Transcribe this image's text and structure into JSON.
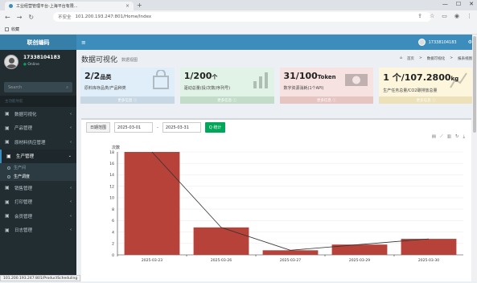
{
  "browser": {
    "tab_title": "工业经营管理平台-上海平台有限...",
    "security": "不安全",
    "url": "101.200.193.247:801/Home/Index",
    "bookmarks_label": "收藏"
  },
  "sidebar": {
    "logo": "联创编码",
    "user_name": "17338104183",
    "user_status": "Online",
    "search_placeholder": "Search",
    "section_header": "主功能导航",
    "items": [
      {
        "label": "数据可视化",
        "icon": "dashboard-icon"
      },
      {
        "label": "产品管理",
        "icon": "product-icon"
      },
      {
        "label": "原材料供应管理",
        "icon": "supply-icon"
      },
      {
        "label": "生产管理",
        "icon": "production-icon",
        "expanded": true,
        "children": [
          {
            "label": "生产间"
          },
          {
            "label": "生产调度"
          }
        ]
      },
      {
        "label": "销售管理",
        "icon": "sales-icon"
      },
      {
        "label": "打印管理",
        "icon": "print-icon"
      },
      {
        "label": "会员管理",
        "icon": "member-icon"
      },
      {
        "label": "日志管理",
        "icon": "log-icon"
      }
    ]
  },
  "topbar": {
    "user": "17338104183"
  },
  "page": {
    "title": "数据可视化",
    "subtitle": "数据视图",
    "breadcrumb": [
      "首页",
      "数据可视化",
      "报表视图"
    ]
  },
  "stats": [
    {
      "value": "2/2",
      "unit": "品类",
      "desc": "原料库存品类/产品种类",
      "foot": "更多信息 ⓘ",
      "icon": "bag-icon",
      "color": "#3c8dbc"
    },
    {
      "value": "1/200",
      "unit": "个",
      "desc": "驱动总量(投/次数/序列号)",
      "foot": "更多信息 ⓘ",
      "icon": "bar-chart-icon",
      "color": "#00a65a"
    },
    {
      "value": "31/100",
      "unit": "Token",
      "desc": "数字资源消耗(1个API)",
      "foot": "更多信息 ⓘ",
      "icon": "money-icon",
      "color": "#dd4b39"
    },
    {
      "value": "1 个/107.2800",
      "unit": "kg",
      "desc": "生产任务总量/CO2碳排放总量",
      "foot": "更多信息 ⓘ",
      "icon": "chart-icon",
      "color": "#f39c12"
    }
  ],
  "filter": {
    "label": "日期范围",
    "start": "2025-03-01",
    "dash": "-",
    "end": "2025-03-31",
    "query": "Q 统计"
  },
  "chart_data": {
    "type": "bar",
    "ylabel": "次数",
    "categories": [
      "2025-03-23",
      "2025-03-26",
      "2025-03-27",
      "2025-03-29",
      "2025-03-30"
    ],
    "values": [
      18,
      4.8,
      0.8,
      1.8,
      2.8
    ],
    "line": [
      18,
      4.8,
      0.8,
      1.8,
      2.8
    ],
    "ylim": [
      0,
      18
    ],
    "yticks": [
      0,
      2,
      4,
      6,
      8,
      10,
      12,
      14,
      16,
      18
    ],
    "bar_color": "#b7423a",
    "line_color": "#333333"
  },
  "status_url": "101.200.193.247:801/ProductScheduling"
}
